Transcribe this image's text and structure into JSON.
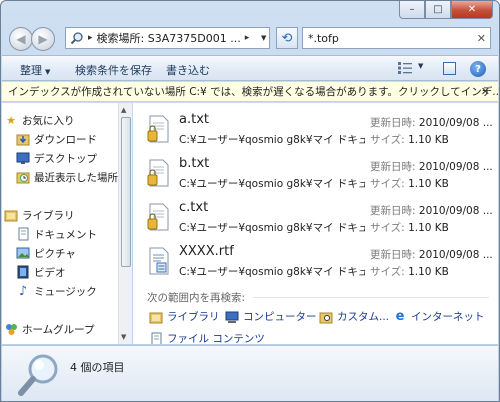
{
  "window": {
    "caption_buttons": {
      "minimize": "–",
      "maximize": "□",
      "close": "✕"
    }
  },
  "address_bar": {
    "path_text": "検索場所: S3A7375D001 ...",
    "separator": "▸"
  },
  "search": {
    "value": "*.tofp",
    "clear_icon": "✕"
  },
  "toolbar": {
    "organize": "整理",
    "save_search": "検索条件を保存",
    "burn": "書き込む",
    "dropdown_glyph": "▼"
  },
  "infobar": {
    "message": "インデックスが作成されていない場所 C:¥ では、検索が遅くなる場合があります。クリックしてインデ...",
    "close": "✕"
  },
  "nav": {
    "favorites": "お気に入り",
    "downloads": "ダウンロード",
    "desktop": "デスクトップ",
    "recent": "最近表示した場所",
    "libraries": "ライブラリ",
    "documents": "ドキュメント",
    "pictures": "ピクチャ",
    "videos": "ビデオ",
    "music": "ミュージック",
    "homegroup": "ホームグループ"
  },
  "results": [
    {
      "name": "a.txt",
      "path": "C:¥ユーザー¥qosmio g8k¥マイ ドキュ...",
      "date_label": "更新日時:",
      "date": "2010/09/08 ...",
      "size_label": "サイズ:",
      "size": "1.10 KB",
      "type": "txt"
    },
    {
      "name": "b.txt",
      "path": "C:¥ユーザー¥qosmio g8k¥マイ ドキュ...",
      "date_label": "更新日時:",
      "date": "2010/09/08 ...",
      "size_label": "サイズ:",
      "size": "1.10 KB",
      "type": "txt"
    },
    {
      "name": "c.txt",
      "path": "C:¥ユーザー¥qosmio g8k¥マイ ドキュ...",
      "date_label": "更新日時:",
      "date": "2010/09/08 ...",
      "size_label": "サイズ:",
      "size": "1.10 KB",
      "type": "txt"
    },
    {
      "name": "XXXX.rtf",
      "path": "C:¥ユーザー¥qosmio g8k¥マイ ドキュ...",
      "date_label": "更新日時:",
      "date": "2010/09/08 ...",
      "size_label": "サイズ:",
      "size": "1.10 KB",
      "type": "rtf"
    }
  ],
  "search_again": {
    "title": "次の範囲内を再検索:",
    "library": "ライブラリ",
    "computer": "コンピューター",
    "custom": "カスタム...",
    "internet": "インターネット",
    "file_contents": "ファイル コンテンツ"
  },
  "details": {
    "item_count": "4 個の項目"
  }
}
